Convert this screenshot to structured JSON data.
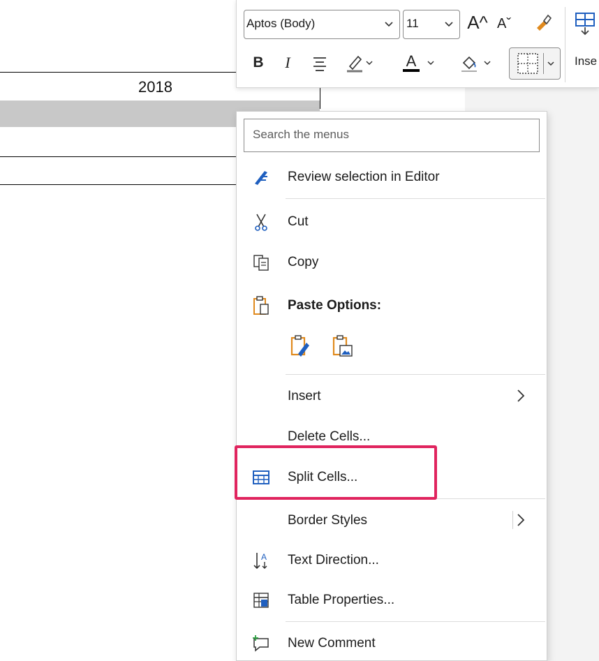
{
  "document": {
    "table_header_value": "2018"
  },
  "mini_toolbar": {
    "font_name": "Aptos (Body)",
    "font_size": "11",
    "grow_font_icon": "A^",
    "shrink_font_icon": "Aˇ",
    "bold_label": "B",
    "italic_label": "I",
    "font_color_label": "A",
    "insert_label": "Inse"
  },
  "context_menu": {
    "search_placeholder": "Search the menus",
    "review_editor_label": "Review selection in Editor",
    "cut_label": "Cut",
    "copy_label": "Copy",
    "paste_options_label": "Paste Options:",
    "insert_label": "Insert",
    "delete_cells_label": "Delete Cells...",
    "split_cells_label": "Split Cells...",
    "border_styles_label": "Border Styles",
    "text_direction_label": "Text Direction...",
    "table_properties_label": "Table Properties...",
    "new_comment_label": "New Comment"
  },
  "colors": {
    "highlight": "#e0245e",
    "accent_blue": "#1f5fbf",
    "paste_orange": "#e08a1e",
    "comment_green": "#2ea043"
  }
}
